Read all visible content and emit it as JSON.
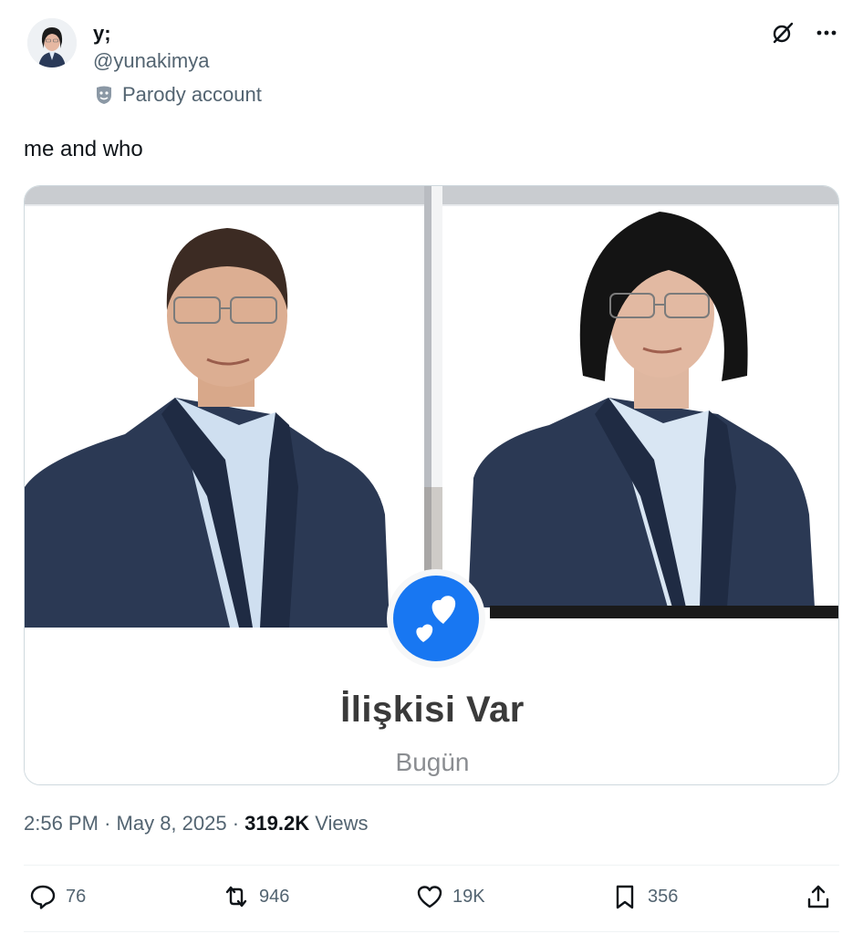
{
  "author": {
    "name": "y;",
    "handle": "@yunakimya",
    "label": "Parody account"
  },
  "tweet": {
    "text": "me and who"
  },
  "media": {
    "title": "İlişkisi Var",
    "subtitle": "Bugün"
  },
  "meta": {
    "time": "2:56 PM",
    "sep1": "·",
    "date": "May 8, 2025",
    "sep2": "·",
    "views_count": "319.2K",
    "views_label": "Views"
  },
  "actions": {
    "replies": "76",
    "reposts": "946",
    "likes": "19K",
    "bookmarks": "356"
  },
  "icons": {
    "grok": "grok-icon",
    "more": "more-icon",
    "reply": "reply-icon",
    "repost": "repost-icon",
    "like": "like-icon",
    "bookmark": "bookmark-icon",
    "share": "share-icon",
    "parody": "theater-mask-icon",
    "relationship": "hearts-icon"
  },
  "colors": {
    "text_primary": "#0f1419",
    "text_secondary": "#536471",
    "relationship_badge": "#1877f2"
  }
}
